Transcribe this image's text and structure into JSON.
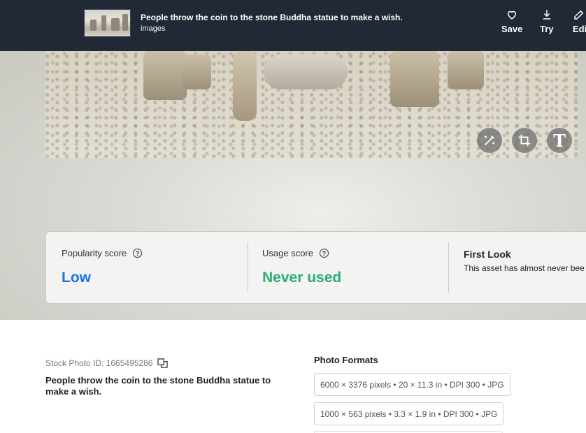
{
  "header": {
    "title": "People throw the coin to the stone Buddha statue to make a wish.",
    "subtitle": "images",
    "actions": [
      {
        "label": "Save",
        "icon": "heart-icon"
      },
      {
        "label": "Try",
        "icon": "download-icon"
      },
      {
        "label": "Edi",
        "icon": "edit-icon"
      }
    ]
  },
  "photo_tools": [
    {
      "icon": "magic-wand-icon"
    },
    {
      "icon": "crop-icon"
    },
    {
      "icon": "text-icon",
      "glyph": "T"
    }
  ],
  "scores": {
    "popularity": {
      "label": "Popularity score",
      "value": "Low",
      "color": "#1a73e8"
    },
    "usage": {
      "label": "Usage score",
      "value": "Never used",
      "color": "#2dae6e"
    },
    "first_look": {
      "title": "First Look",
      "text": "This asset has almost never bee"
    },
    "help_glyph": "?"
  },
  "details": {
    "stock_id": "Stock Photo ID: 1665495286",
    "description": "People throw the coin to the stone Buddha statue to make a wish.",
    "formats_title": "Photo Formats",
    "formats": [
      "6000 × 3376 pixels • 20 × 11.3 in • DPI 300 • JPG",
      "1000 × 563 pixels • 3.3 × 1.9 in • DPI 300 • JPG"
    ]
  },
  "colors": {
    "topbar": "#212936",
    "accent_blue": "#1a73e8",
    "accent_green": "#2dae6e"
  }
}
